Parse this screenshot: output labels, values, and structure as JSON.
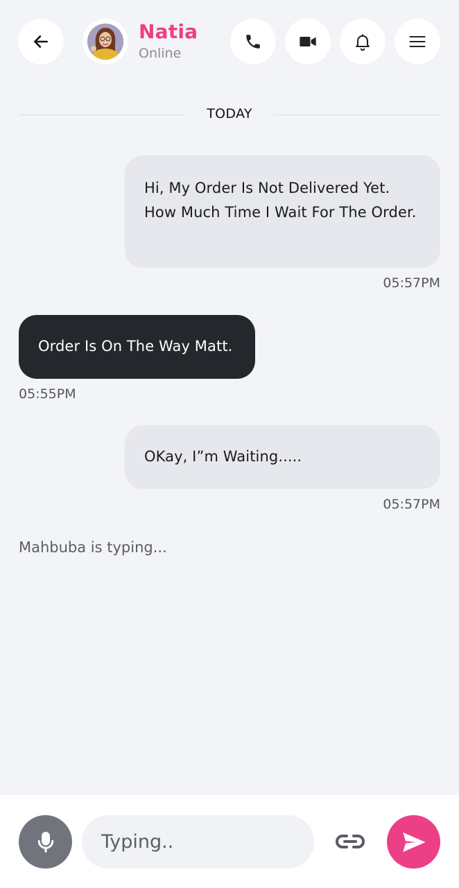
{
  "header": {
    "contact_name": "Natia",
    "contact_status": "Online",
    "icons": {
      "back": "arrow-left-icon",
      "call": "phone-icon",
      "video": "video-camera-icon",
      "notifications": "bell-icon",
      "menu": "hamburger-menu-icon"
    }
  },
  "date_divider": "TODAY",
  "messages": [
    {
      "direction": "outgoing",
      "text": "Hi, My Order Is Not Delivered Yet. How Much Time I Wait For The Order.",
      "time": "05:57PM"
    },
    {
      "direction": "incoming",
      "text": "Order Is On The Way Matt.",
      "time": "05:55PM"
    },
    {
      "direction": "outgoing",
      "text": "OKay, I”m Waiting.....",
      "time": "05:57PM"
    }
  ],
  "typing_status": "Mahbuba is typing...",
  "composer": {
    "placeholder": "Typing..",
    "value": "",
    "icons": {
      "mic": "microphone-icon",
      "attach": "link-icon",
      "send": "send-icon"
    }
  },
  "colors": {
    "accent": "#ec3f86",
    "background": "#f3f4f7",
    "outgoing_bubble": "#e7e8ed",
    "incoming_bubble": "#24272c",
    "mic_button": "#71747c"
  }
}
